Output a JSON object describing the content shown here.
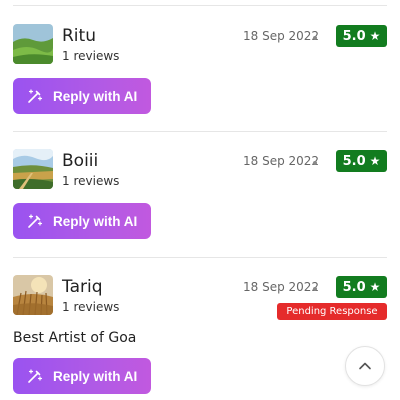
{
  "reviews": [
    {
      "name": "Ritu",
      "reviews_count": "1 reviews",
      "date": "18 Sep 2022",
      "rating": "5.0",
      "rating_color": "#127c1f",
      "button_label": "Reply with AI",
      "avatar": "green-hills-photo"
    },
    {
      "name": "Boiii",
      "reviews_count": "1 reviews",
      "date": "18 Sep 2022",
      "rating": "5.0",
      "rating_color": "#127c1f",
      "button_label": "Reply with AI",
      "avatar": "countryside-field-photo"
    },
    {
      "name": "Tariq",
      "reviews_count": "1 reviews",
      "date": "18 Sep 2022",
      "rating": "5.0",
      "rating_color": "#127c1f",
      "status": "Pending Response",
      "status_color": "#e52b2b",
      "comment": "Best Artist of Goa",
      "button_label": "Reply with AI",
      "avatar": "wheat-field-photo"
    }
  ],
  "icons": {
    "rating": "star-icon",
    "button": "magic-wand-icon",
    "scroll": "chevron-up-icon"
  },
  "accent_gradient": [
    "#9a53f0",
    "#c159df"
  ]
}
